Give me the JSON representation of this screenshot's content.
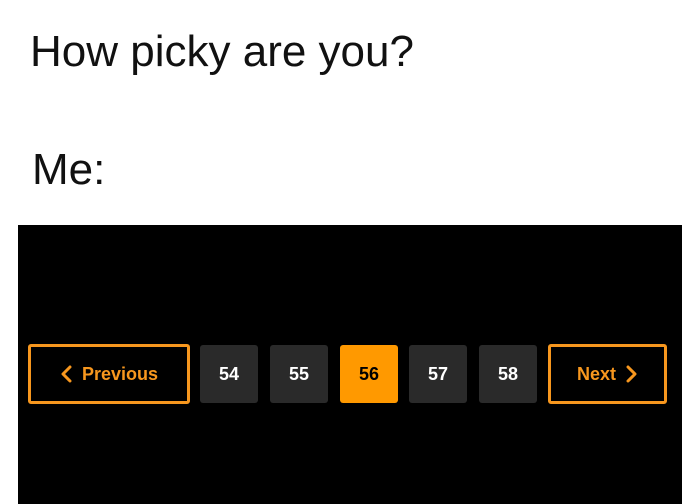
{
  "meme": {
    "question": "How picky are you?",
    "answer_label": "Me:"
  },
  "pagination": {
    "previous_label": "Previous",
    "next_label": "Next",
    "pages": [
      "54",
      "55",
      "56",
      "57",
      "58"
    ],
    "current_page": "56",
    "accent_color": "#f7971e",
    "icons": {
      "previous": "chevron-left-icon",
      "next": "chevron-right-icon"
    }
  }
}
